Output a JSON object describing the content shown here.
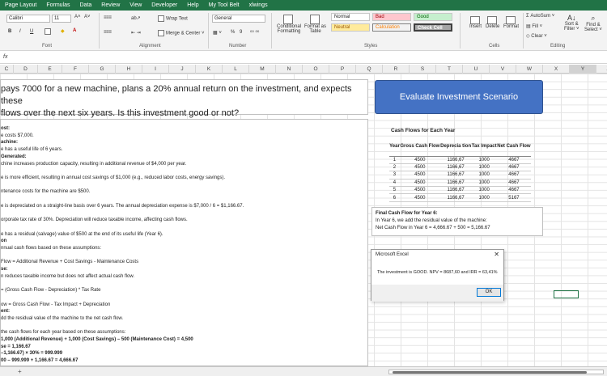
{
  "menu": [
    "Page Layout",
    "Formulas",
    "Data",
    "Review",
    "View",
    "Developer",
    "Help",
    "My Tool Belt",
    "xlwings"
  ],
  "ribbon": {
    "font_name": "Calibri",
    "font_size": "11",
    "bold": "B",
    "italic": "I",
    "underline": "U",
    "wrap_text": "Wrap Text",
    "merge_center": "Merge & Center",
    "number_format": "General",
    "percent": "%",
    "conditional_formatting_1": "Conditional",
    "conditional_formatting_2": "Formatting",
    "format_as_table_1": "Format as",
    "format_as_table_2": "Table",
    "styles": {
      "normal": "Normal",
      "bad": "Bad",
      "good": "Good",
      "neutral": "Neutral",
      "calculation": "Calculation",
      "check_cell": "Check Cell"
    },
    "insert": "Insert",
    "delete": "Delete",
    "format": "Format",
    "autosum": "AutoSum",
    "fill": "Fill",
    "clear": "Clear",
    "sort_filter_1": "Sort &",
    "sort_filter_2": "Filter",
    "find_select_1": "Find &",
    "find_select_2": "Select",
    "group_labels": {
      "font": "Font",
      "alignment": "Alignment",
      "number": "Number",
      "styles": "Styles",
      "cells": "Cells",
      "editing": "Editing"
    }
  },
  "formula_bar": {
    "fx": "fx"
  },
  "columns": [
    "C",
    "D",
    "E",
    "F",
    "G",
    "H",
    "I",
    "J",
    "K",
    "L",
    "M",
    "N",
    "O",
    "P",
    "Q",
    "R",
    "S",
    "T",
    "U",
    "V",
    "W",
    "X",
    "Y",
    "Z"
  ],
  "title_text": {
    "line1": "pays 7000 for a new machine, plans a 20% annual return on the investment, and expects these",
    "line2": " flows over the next six years. Is this investment good or not?"
  },
  "body_lines": [
    {
      "t": "ost:",
      "b": true
    },
    {
      "t": "e costs $7,000.",
      "b": false
    },
    {
      "t": "achine:",
      "b": true
    },
    {
      "t": "e has a useful life of 6 years.",
      "b": false
    },
    {
      "t": "Generated:",
      "b": true
    },
    {
      "t": "chine increases production capacity, resulting in additional revenue of $4,000 per year.",
      "b": false
    },
    {
      "t": "",
      "b": false
    },
    {
      "t": "e is more efficient, resulting in annual cost savings of $1,000 (e.g., reduced labor costs, energy savings).",
      "b": false
    },
    {
      "t": "",
      "b": false
    },
    {
      "t": "ntenance costs for the machine are $500.",
      "b": false
    },
    {
      "t": "",
      "b": false
    },
    {
      "t": "e is depreciated on a straight-line basis over 6 years. The annual depreciation expense is $7,000 / 6 = $1,166.67.",
      "b": false
    },
    {
      "t": "",
      "b": false
    },
    {
      "t": "orporate tax rate of 30%. Depreciation will reduce taxable income, affecting cash flows.",
      "b": false
    },
    {
      "t": "",
      "b": false
    },
    {
      "t": "e has a residual (salvage) value of $500 at the end of its useful life (Year 6).",
      "b": false
    },
    {
      "t": "on",
      "b": true
    },
    {
      "t": "nnual cash flows based on these assumptions:",
      "b": false
    },
    {
      "t": "",
      "b": false
    },
    {
      "t": "Flow = Additional Revenue + Cost Savings - Maintenance Costs",
      "b": false
    },
    {
      "t": "se:",
      "b": true
    },
    {
      "t": "n reduces taxable income but does not affect actual cash flow.",
      "b": false
    },
    {
      "t": "",
      "b": false
    },
    {
      "t": "= (Gross Cash Flow - Depreciation) * Tax Rate",
      "b": false
    },
    {
      "t": "",
      "b": false
    },
    {
      "t": "ow = Gross Cash Flow - Tax Impact + Depreciation",
      "b": false
    },
    {
      "t": "ent:",
      "b": true
    },
    {
      "t": "dd the residual value of the machine to the net cash flow.",
      "b": false
    },
    {
      "t": "",
      "b": false
    },
    {
      "t": "the cash flows for each year based on these assumptions:",
      "b": false
    },
    {
      "t": "1,000 (Additional Revenue) + 1,000 (Cost Savings) – 500 (Maintenance Cost) = 4,500",
      "b": true
    },
    {
      "t": "se = 1,166.67",
      "b": true
    },
    {
      "t": "–1,166.67) × 30% = 999.999",
      "b": true
    },
    {
      "t": "00 – 999.999 + 1,166.67 = 4,666.67",
      "b": true
    }
  ],
  "eval_button": "Evaluate Investment Scenario",
  "table": {
    "title": "Cash Flows for Each Year",
    "headers": [
      "Year",
      "Gross Cash Flow",
      "Deprecia tion",
      "Tax Impact",
      "Net Cash Flow"
    ],
    "rows": [
      [
        "1",
        "4500",
        "1166,67",
        "1000",
        "4667"
      ],
      [
        "2",
        "4500",
        "1166,67",
        "1000",
        "4667"
      ],
      [
        "3",
        "4500",
        "1166,67",
        "1000",
        "4667"
      ],
      [
        "4",
        "4500",
        "1166,67",
        "1000",
        "4667"
      ],
      [
        "5",
        "4500",
        "1166,67",
        "1000",
        "4667"
      ],
      [
        "6",
        "4500",
        "1166,67",
        "1000",
        "5167"
      ]
    ]
  },
  "final_box": {
    "line1": "Final Cash Flow for Year 6:",
    "line2": "In Year 6, we add the residual value of the machine:",
    "line3": "Net Cash Flow in Year 6 = 4,666.67 + 500 = 5,166.67"
  },
  "dialog": {
    "title": "Microsoft Excel",
    "close": "✕",
    "message": "The investment is GOOD. NPV = 8687,60 and IRR = 63,41%",
    "ok": "OK"
  },
  "bottom": {
    "plus": "+"
  }
}
